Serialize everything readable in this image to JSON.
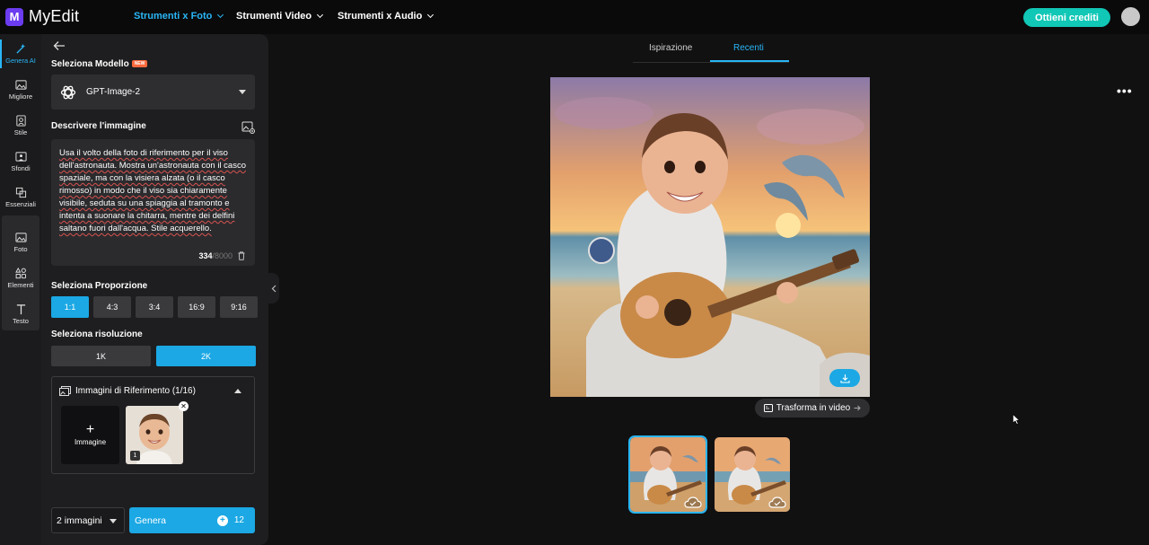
{
  "app": {
    "name": "MyEdit",
    "logo_letter": "M"
  },
  "nav": [
    {
      "label": "Strumenti x Foto",
      "active": true
    },
    {
      "label": "Strumenti Video",
      "active": false
    },
    {
      "label": "Strumenti x Audio",
      "active": false
    }
  ],
  "header": {
    "credits_button": "Ottieni crediti"
  },
  "rail": [
    {
      "label": "Genera AI",
      "icon": "wand-icon",
      "active": true
    },
    {
      "label": "Migliore",
      "icon": "image-enhance-icon",
      "active": false
    },
    {
      "label": "Stile",
      "icon": "style-icon",
      "active": false
    },
    {
      "label": "Sfondi",
      "icon": "background-icon",
      "active": false
    },
    {
      "label": "Essenziali",
      "icon": "crop-icon",
      "active": false
    },
    {
      "label": "Foto",
      "icon": "photo-icon",
      "active": false
    },
    {
      "label": "Elementi",
      "icon": "elements-icon",
      "active": false
    },
    {
      "label": "Testo",
      "icon": "text-icon",
      "active": false
    }
  ],
  "panel": {
    "model_title": "Seleziona Modello",
    "model_badge": "NEW",
    "model_name": "GPT-Image-2",
    "describe_title": "Descrivere l'immagine",
    "prompt": "Usa il volto della foto di riferimento per il viso dell'astronauta. Mostra un'astronauta con il casco spaziale, ma con la visiera alzata (o il casco rimosso) in modo che il viso sia chiaramente visibile, seduta su una spiaggia al tramonto e intenta a suonare la chitarra, mentre dei delfini saltano fuori dall'acqua. Stile acquerello.",
    "char_count": "334",
    "char_max": "/8000",
    "ratio_title": "Seleziona Proporzione",
    "ratios": [
      {
        "label": "1:1",
        "active": true
      },
      {
        "label": "4:3",
        "active": false
      },
      {
        "label": "3:4",
        "active": false
      },
      {
        "label": "16:9",
        "active": false
      },
      {
        "label": "9:16",
        "active": false
      }
    ],
    "resolution_title": "Seleziona risoluzione",
    "resolutions": [
      {
        "label": "1K",
        "active": false
      },
      {
        "label": "2K",
        "active": true
      }
    ],
    "reference_title": "Immagini di Riferimento (1/16)",
    "add_image_label": "Immagine",
    "reference_index": "1",
    "count_select": "2 immagini",
    "generate_label": "Genera",
    "generate_cost": "12"
  },
  "main": {
    "tabs": [
      {
        "label": "Ispirazione",
        "active": false
      },
      {
        "label": "Recenti",
        "active": true
      }
    ],
    "video_button": "Trasforma in video"
  },
  "colors": {
    "accent": "#29b6f6",
    "primary_button": "#1ba8e4",
    "credit_button": "#11c7b6",
    "brand": "#6b3cf0"
  }
}
